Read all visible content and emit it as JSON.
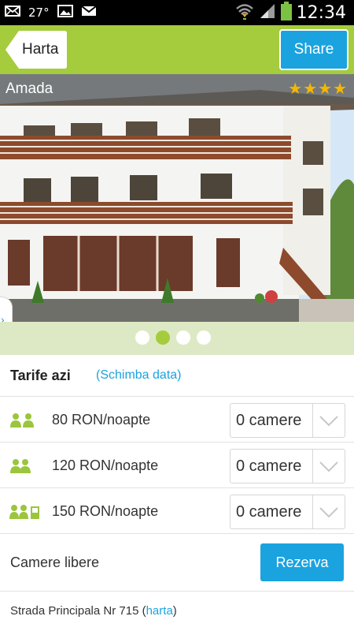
{
  "status_bar": {
    "temperature": "27°",
    "time": "12:34",
    "left_icons": [
      "mail-icon",
      "image-icon",
      "email-icon"
    ],
    "right_icons": [
      "wifi-icon",
      "signal-icon",
      "battery-icon"
    ]
  },
  "topbar": {
    "back_label": "Harta",
    "share_label": "Share",
    "color": "#a4cc3c"
  },
  "hotel": {
    "name": "Amada",
    "stars": "★★★★",
    "star_count": 4,
    "photo_count": 4,
    "active_photo": 2
  },
  "rates": {
    "title": "Tarife azi",
    "change_date": "(Schimba data)",
    "rooms": [
      {
        "icon": "double-person-icon",
        "price": "80 RON/noapte",
        "select_value": "0 camere"
      },
      {
        "icon": "double-person-icon",
        "price": "120 RON/noapte",
        "select_value": "0 camere"
      },
      {
        "icon": "two-persons-plus-bed-icon",
        "price": "150 RON/noapte",
        "select_value": "0 camere"
      }
    ]
  },
  "availability": {
    "label": "Camere libere",
    "reserve_label": "Rezerva"
  },
  "address": {
    "text": "Strada Principala Nr 715 (",
    "link": "harta",
    "close": ")"
  },
  "colors": {
    "accent_green": "#a4cc3c",
    "accent_blue": "#1aa3df",
    "star": "#f5b800"
  }
}
